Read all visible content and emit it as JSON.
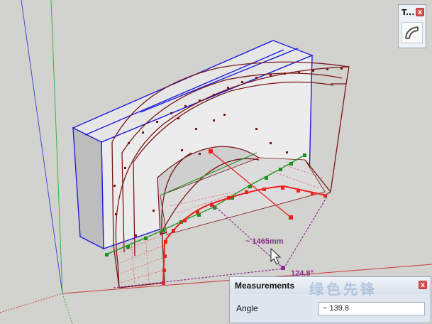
{
  "tray": {
    "title": "T...",
    "close_label": "x",
    "tool_icon": "arc-tool-icon"
  },
  "viewport": {
    "distance_label": "~ 1465mm",
    "angle_label": "124.8°"
  },
  "measurements": {
    "title": "Measurements",
    "watermark": "绿色先锋",
    "close_label": "x",
    "field_label": "Angle",
    "field_value": "~ 139.8"
  },
  "colors": {
    "edges": "#7a1616",
    "selection": "#1f1fdd",
    "guide": "#8e2d8e",
    "axis_red": "#cc3333",
    "axis_green": "#2aa12a",
    "axis_blue": "#4444cc"
  }
}
